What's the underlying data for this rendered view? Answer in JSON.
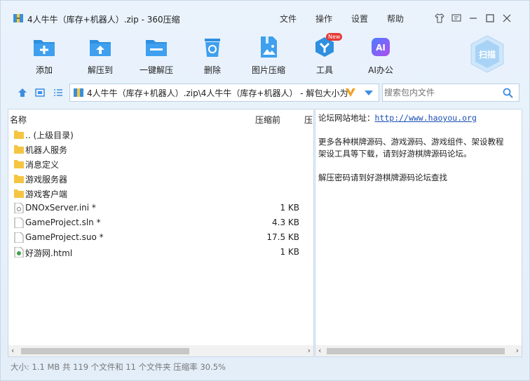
{
  "window": {
    "title": "4人牛牛（库存+机器人）.zip - 360压缩",
    "menus": [
      "文件",
      "操作",
      "设置",
      "帮助"
    ]
  },
  "toolbar": {
    "items": [
      {
        "label": "添加",
        "icon": "add-folder-icon"
      },
      {
        "label": "解压到",
        "icon": "extract-to-icon"
      },
      {
        "label": "一键解压",
        "icon": "one-click-extract-icon"
      },
      {
        "label": "删除",
        "icon": "recycle-bin-icon"
      },
      {
        "label": "图片压缩",
        "icon": "image-compress-icon"
      },
      {
        "label": "工具",
        "icon": "tools-icon",
        "badge": "New"
      },
      {
        "label": "AI办公",
        "icon": "ai-office-icon",
        "icon_text": "AI"
      }
    ],
    "scan_label": "扫描"
  },
  "address": {
    "path": "4人牛牛（库存+机器人）.zip\\4人牛牛（库存+机器人） - 解包大小为",
    "search_placeholder": "搜索包内文件"
  },
  "file_list": {
    "columns": {
      "name": "名称",
      "packed": "压缩前",
      "extra": "压"
    },
    "rows": [
      {
        "name": ".. (上级目录)",
        "size": "",
        "type": "folder"
      },
      {
        "name": "机器人服务",
        "size": "",
        "type": "folder"
      },
      {
        "name": "消息定义",
        "size": "",
        "type": "folder"
      },
      {
        "name": "游戏服务器",
        "size": "",
        "type": "folder"
      },
      {
        "name": "游戏客户端",
        "size": "",
        "type": "folder"
      },
      {
        "name": "DNOxServer.ini *",
        "size": "1 KB",
        "type": "ini"
      },
      {
        "name": "GameProject.sln *",
        "size": "4.3 KB",
        "type": "file"
      },
      {
        "name": "GameProject.suo *",
        "size": "17.5 KB",
        "type": "file"
      },
      {
        "name": "好游网.html",
        "size": "1 KB",
        "type": "html"
      }
    ]
  },
  "preview": {
    "line1_prefix": "论坛网站地址：",
    "line1_link": "http://www.haoyou.org",
    "line2": "更多各种棋牌源码、游戏源码、游戏组件、架设教程",
    "line3": "架设工具等下载，请到好游棋牌源码论坛。",
    "line4": "解压密码请到好游棋牌源码论坛查找"
  },
  "status": "大小: 1.1 MB 共 119 个文件和 11 个文件夹 压缩率 30.5%",
  "colors": {
    "accent": "#2f8fe0",
    "folder": "#f5c542",
    "badge": "#e53935"
  }
}
